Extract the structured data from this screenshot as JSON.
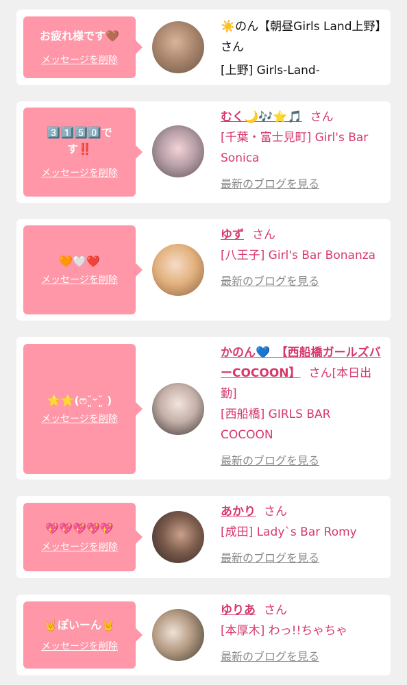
{
  "colors": {
    "bubble": "#ff97a8",
    "accent": "#d6386a",
    "muted": "#888888",
    "background": "#f0f0f0"
  },
  "cards": [
    {
      "message": "お疲れ様です🤎",
      "delete_label": "メッセージを削除",
      "name": "☀️のん【朝昼Girls Land上野】",
      "honorific": "さん",
      "shop": "[上野] Girls-Land-",
      "blog_label": ""
    },
    {
      "message": "3️⃣1️⃣5️⃣0️⃣です‼️",
      "delete_label": "メッセージを削除",
      "name": "むく🌙🎶⭐️🎵",
      "honorific": "さん",
      "shop": "[千葉・富士見町] Girl's Bar Sonica",
      "blog_label": "最新のブログを見る"
    },
    {
      "message": "🧡🤍❤️",
      "delete_label": "メッセージを削除",
      "name": "ゆず",
      "honorific": "さん",
      "shop": "[八王子] Girl's Bar Bonanza",
      "blog_label": "最新のブログを見る"
    },
    {
      "message": "⭐️⭐️(ෆ˘͈ᵕ˘͈ )",
      "delete_label": "メッセージを削除",
      "name": "かのん💙　【西船橋ガールズバーCOCOON】",
      "honorific": "さん",
      "status": "[本日出勤]",
      "shop": "[西船橋] GIRLS BAR COCOON",
      "blog_label": "最新のブログを見る"
    },
    {
      "message": "💖💖💖💖💖",
      "delete_label": "メッセージを削除",
      "name": "あかり",
      "honorific": "さん",
      "shop": "[成田] Lady`s Bar Romy",
      "blog_label": "最新のブログを見る"
    },
    {
      "message": "🤘ぽいーん🤘",
      "delete_label": "メッセージを削除",
      "name": "ゆりあ",
      "honorific": "さん",
      "shop": "[本厚木] わっ!!ちゃちゃ",
      "blog_label": "最新のブログを見る"
    }
  ]
}
